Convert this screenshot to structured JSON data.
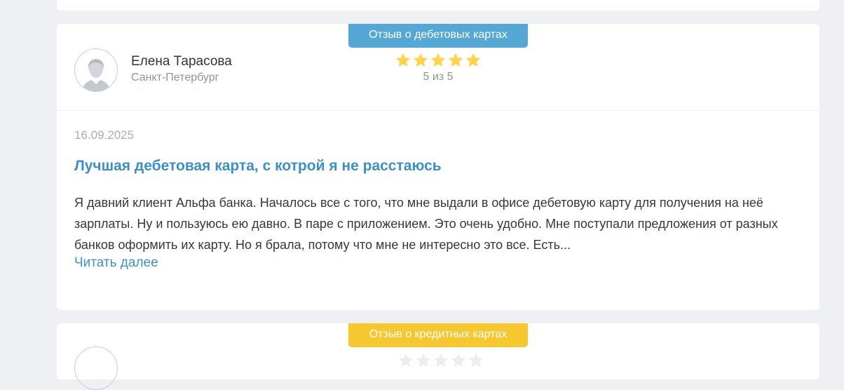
{
  "review": {
    "badge": "Отзыв о дебетовых картах",
    "author_name": "Елена Тарасова",
    "author_city": "Санкт-Петербург",
    "rating_value": 5,
    "rating_max": 5,
    "rating_text": "5 из 5",
    "date": "16.09.2025",
    "title": "Лучшая дебетовая карта, с котрой я не расстаюсь",
    "body": "Я давний клиент Альфа банка. Началось все с того, что мне выдали в офисе дебетовую карту для получения на неё зарплаты. Ну и пользуюсь ею давно. В паре с приложением. Это очень удобно. Мне поступали предложения от разных банков оформить их карту. Но я брала, потому что мне не интересно это все. Есть...",
    "read_more": "Читать далее"
  },
  "next_review": {
    "badge": "Отзыв о кредитных картах"
  },
  "colors": {
    "debit_badge": "#55a7d6",
    "credit_badge": "#f6c72f",
    "star": "#ffd34d",
    "link": "#3d8fc4"
  },
  "icons": {
    "avatar": "user-avatar-icon",
    "star": "star-icon"
  }
}
